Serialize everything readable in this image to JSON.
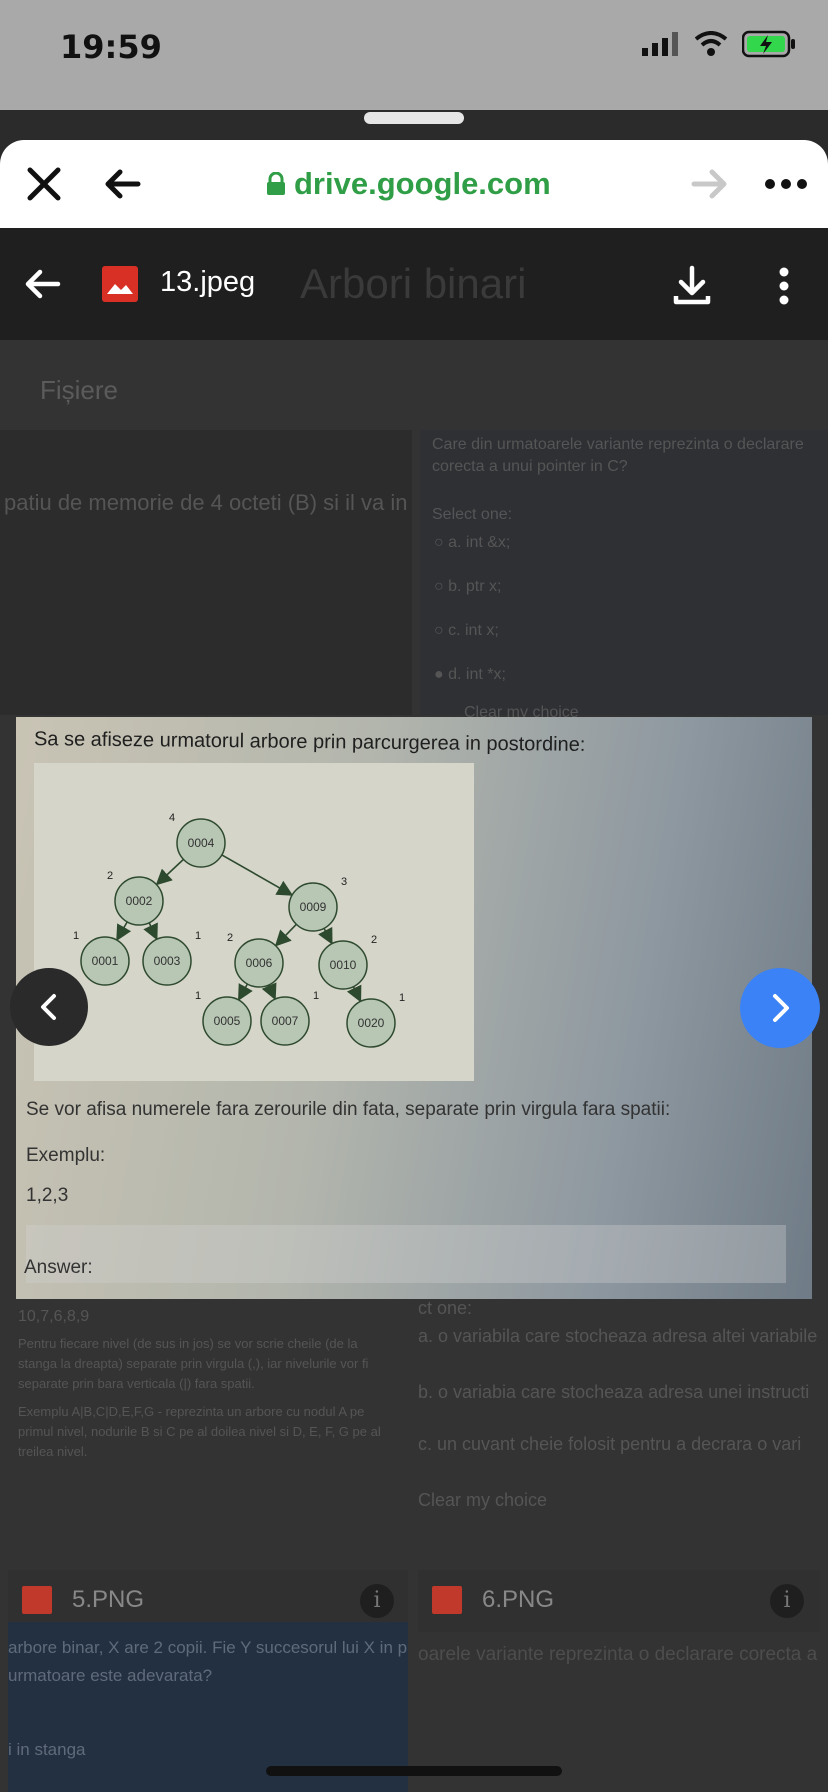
{
  "status": {
    "time": "19:59"
  },
  "browser": {
    "url": "drive.google.com"
  },
  "viewer": {
    "file_name": "13.jpeg",
    "background_title": "Arbori binari",
    "background_section": "Fișiere"
  },
  "background": {
    "left_snippet": "patiu de memorie de 4 octeti (B) si il va in",
    "right_question": "Care din urmatoarele variante reprezinta o declarare corecta a unui pointer in C?",
    "select_one": "Select one:",
    "options": [
      "a. int &x;",
      "b. ptr x;",
      "c. int x;",
      "d. int *x;"
    ],
    "clear_choice": "Clear my choice",
    "bottom_left_value": "10,7,6,8,9",
    "bottom_left_text": "Pentru fiecare nivel (de sus in jos) se vor scrie cheile (de la stanga la dreapta) separate prin virgula (,), iar nivelurile vor fi separate prin bara verticala (|) fara spatii.",
    "bottom_left_example": "Exemplu A|B,C|D,E,F,G - reprezinta un arbore cu nodul A pe primul nivel, nodurile B si C pe al doilea nivel si D, E, F, G pe al treilea nivel.",
    "bottom_right_select": "ct one:",
    "bottom_right_options": [
      "a. o variabila care stocheaza adresa altei variabile",
      "b. o variabia care stocheaza adresa unei instructi",
      "c. un cuvant cheie folosit pentru a decrara o vari"
    ],
    "bottom_right_clear": "Clear my choice",
    "thumb1_name": "5.PNG",
    "thumb2_name": "6.PNG",
    "lower_left_text": "arbore binar, X are 2 copii. Fie Y succesorul lui X in p urmatoare este adevarata?",
    "lower_left_text2": "i in stanga",
    "lower_right_text": "oarele variante reprezinta o declarare corecta a"
  },
  "preview": {
    "question": "Sa se afiseze urmatorul arbore prin parcurgerea in postordine:",
    "instruction": "Se vor afisa numerele fara zerourile din fata, separate prin virgula fara spatii:",
    "example_label": "Exemplu:",
    "example_value": "1,2,3",
    "answer_label": "Answer:"
  },
  "tree": {
    "nodes": [
      {
        "id": "n4",
        "label": "0004",
        "height": "4"
      },
      {
        "id": "n2",
        "label": "0002",
        "height": "2"
      },
      {
        "id": "n9",
        "label": "0009",
        "height": "3"
      },
      {
        "id": "n1",
        "label": "0001",
        "height": "1"
      },
      {
        "id": "n3",
        "label": "0003",
        "height": "1"
      },
      {
        "id": "n6",
        "label": "0006",
        "height": "2"
      },
      {
        "id": "n10",
        "label": "0010",
        "height": "2"
      },
      {
        "id": "n5",
        "label": "0005",
        "height": "1"
      },
      {
        "id": "n7",
        "label": "0007",
        "height": "1"
      },
      {
        "id": "n20",
        "label": "0020",
        "height": "1"
      }
    ],
    "edges": [
      [
        "n4",
        "n2"
      ],
      [
        "n4",
        "n9"
      ],
      [
        "n2",
        "n1"
      ],
      [
        "n2",
        "n3"
      ],
      [
        "n9",
        "n6"
      ],
      [
        "n9",
        "n10"
      ],
      [
        "n6",
        "n5"
      ],
      [
        "n6",
        "n7"
      ],
      [
        "n10",
        "n20"
      ]
    ]
  },
  "colors": {
    "url_green": "#2f9e46",
    "next_blue": "#3b82f6",
    "file_red": "#d93025"
  }
}
